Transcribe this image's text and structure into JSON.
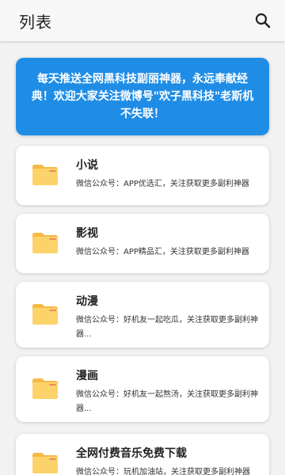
{
  "header": {
    "title": "列表",
    "search_icon": "search-icon"
  },
  "banner": {
    "text": "每天推送全网黑科技副丽神器，永远奉献经典！欢迎大家关注微博号\"欢子黑科技\"老斯机不失联！",
    "background": "#1f8de6"
  },
  "items": [
    {
      "title": "小说",
      "description": "微信公众号：APP优选汇，关注获取更多副利神器",
      "icon": "folder-icon"
    },
    {
      "title": "影视",
      "description": "微信公众号：APP精品汇，关注获取更多副利神器",
      "icon": "folder-icon"
    },
    {
      "title": "动漫",
      "description": "微信公众号：好机友一起吃瓜，关注获取更多副利神器...",
      "icon": "folder-icon"
    },
    {
      "title": "漫画",
      "description": "微信公众号：好机友一起熬汤，关注获取更多副利神器...",
      "icon": "folder-icon"
    },
    {
      "title": "全网付费音乐免费下载",
      "description": "微信公众号：玩机加油站，关注获取更多副利神器",
      "icon": "folder-icon"
    }
  ],
  "colors": {
    "folder_body": "#fbd36a",
    "folder_tab": "#f5b945"
  }
}
